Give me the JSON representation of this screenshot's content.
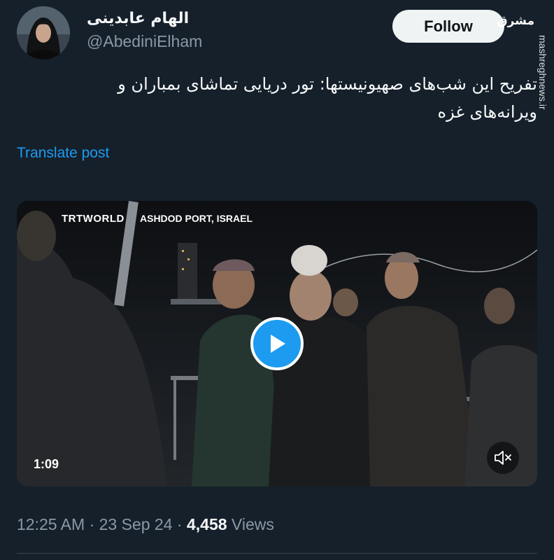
{
  "author": {
    "display_name": "الهام عابدینی",
    "handle": "@AbediniElham"
  },
  "follow_button": {
    "label": "Follow"
  },
  "watermark": {
    "site": "mashreghnews.ir"
  },
  "post": {
    "text_line1": "تفریح این شب‌های صهیونیستها: تور دریایی تماشای بمباران و",
    "text_line2": "ویرانه‌های غزه",
    "translate_label": "Translate post"
  },
  "video": {
    "channel_logo": "TRTWORLD",
    "location_caption": "ASHDOD PORT, ISRAEL",
    "duration": "1:09",
    "play_icon": "play-icon",
    "mute_icon": "speaker-muted-icon"
  },
  "meta": {
    "time": "12:25 AM",
    "date": "23 Sep 24",
    "views_count": "4,458",
    "views_label": "Views"
  },
  "colors": {
    "background": "#15202b",
    "link": "#1d9bf0",
    "secondary_text": "#8b98a5",
    "play_button": "#1d9bf0"
  }
}
